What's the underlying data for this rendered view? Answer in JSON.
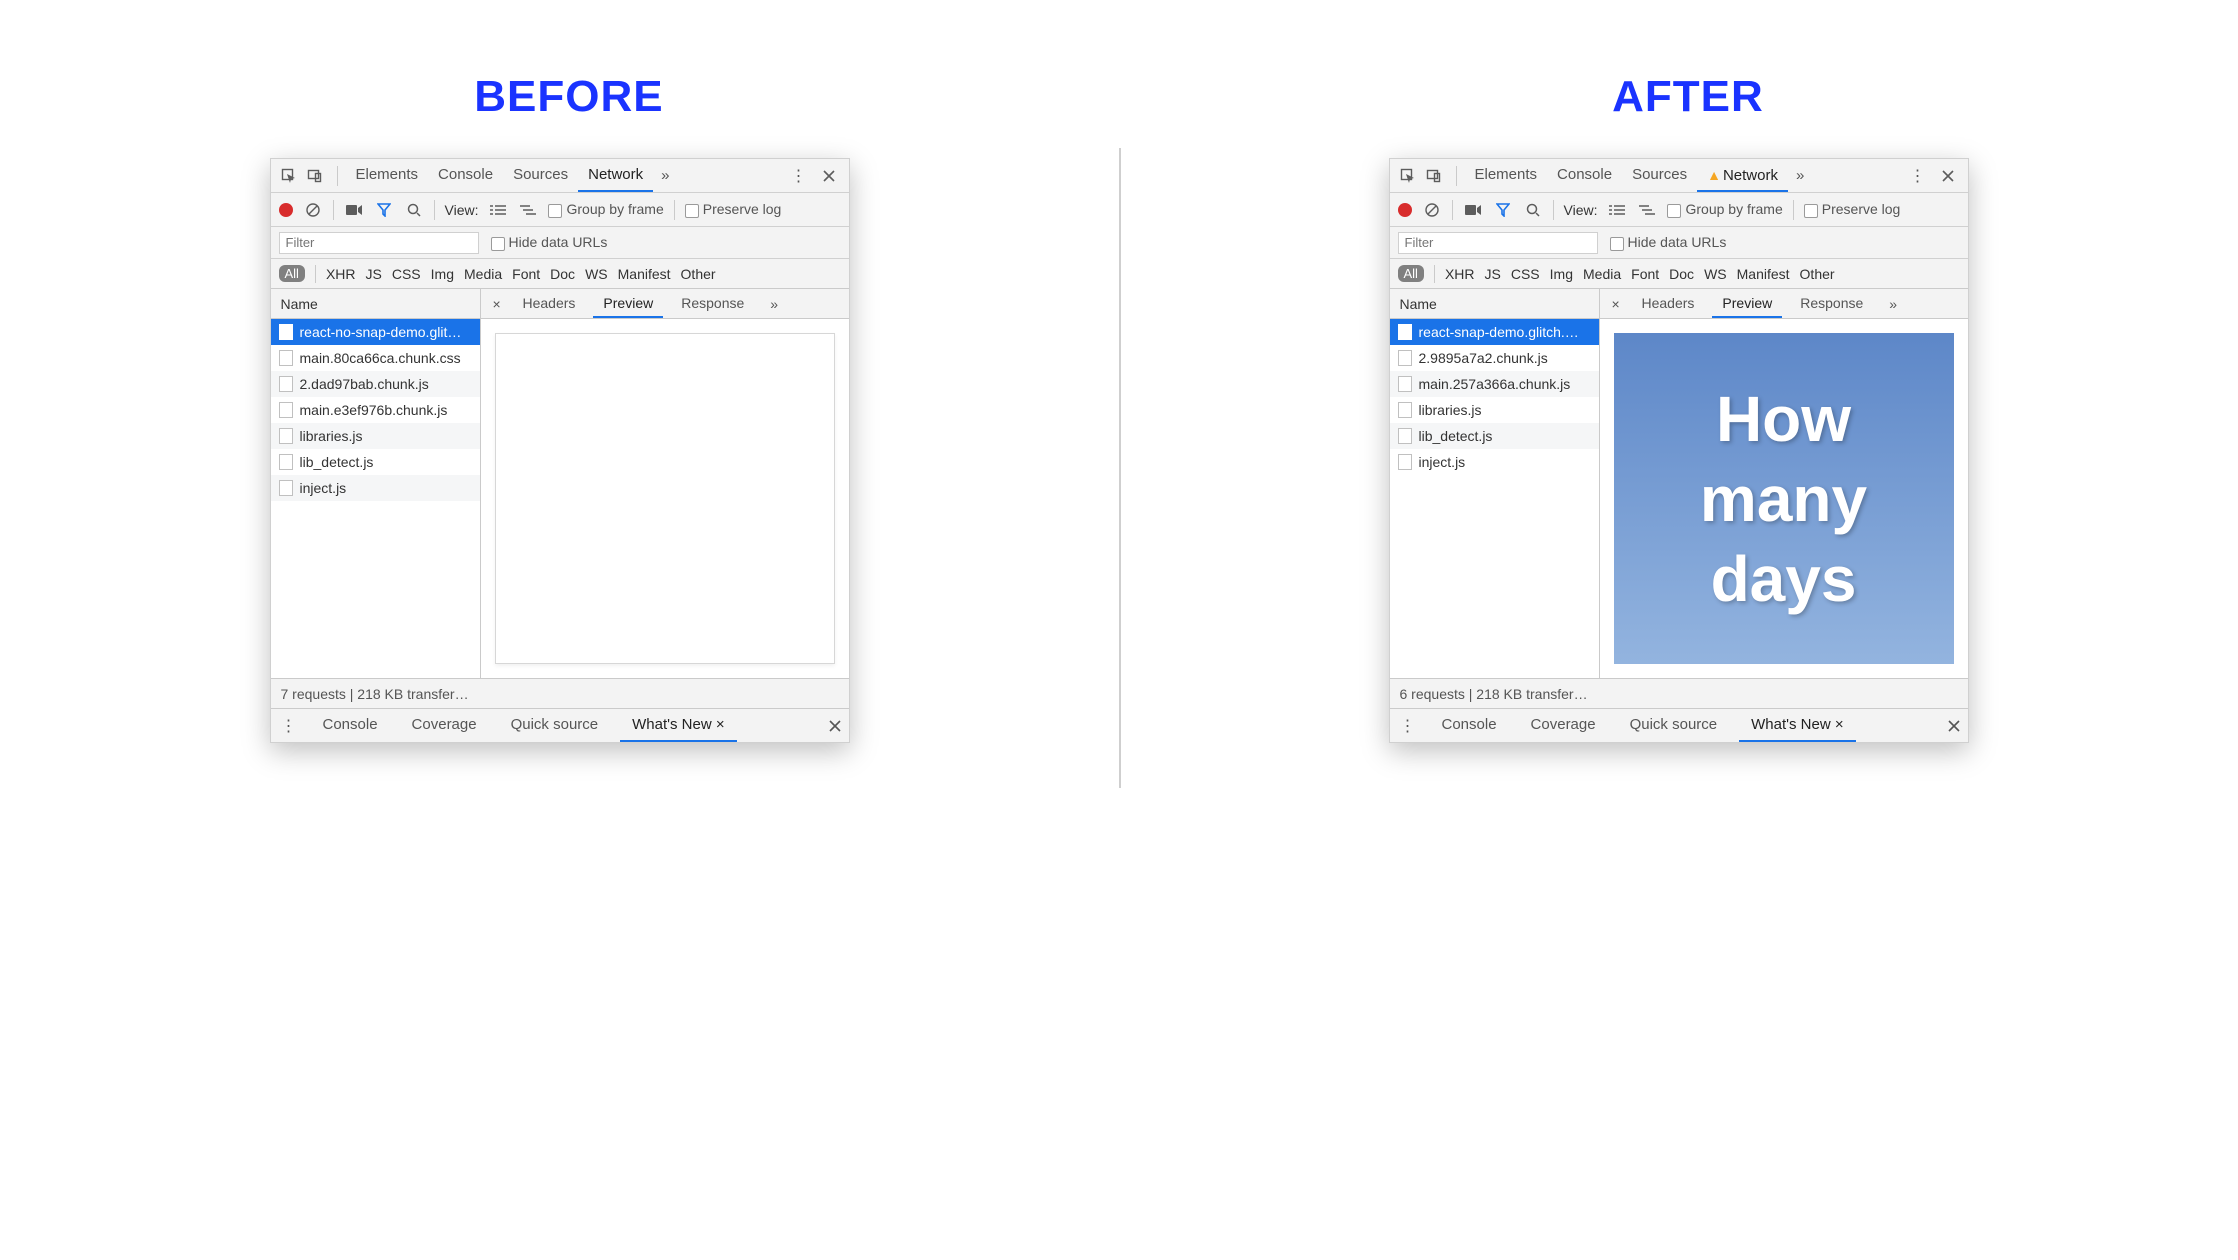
{
  "headings": {
    "before": "BEFORE",
    "after": "AFTER"
  },
  "top_tabs": {
    "elements": "Elements",
    "console": "Console",
    "sources": "Sources",
    "network": "Network"
  },
  "toolbar": {
    "view_label": "View:",
    "group_by_frame": "Group by frame",
    "preserve_log": "Preserve log"
  },
  "filter": {
    "placeholder": "Filter",
    "hide_data_urls": "Hide data URLs"
  },
  "type_filters": {
    "all": "All",
    "xhr": "XHR",
    "js": "JS",
    "css": "CSS",
    "img": "Img",
    "media": "Media",
    "font": "Font",
    "doc": "Doc",
    "ws": "WS",
    "manifest": "Manifest",
    "other": "Other"
  },
  "columns": {
    "name": "Name"
  },
  "subtabs": {
    "headers": "Headers",
    "preview": "Preview",
    "response": "Response"
  },
  "drawer": {
    "console": "Console",
    "coverage": "Coverage",
    "quick_source": "Quick source",
    "whats_new": "What's New"
  },
  "before": {
    "requests": [
      "react-no-snap-demo.glit…",
      "main.80ca66ca.chunk.css",
      "2.dad97bab.chunk.js",
      "main.e3ef976b.chunk.js",
      "libraries.js",
      "lib_detect.js",
      "inject.js"
    ],
    "status": "7 requests | 218 KB transfer…",
    "warning": false
  },
  "after": {
    "requests": [
      "react-snap-demo.glitch.…",
      "2.9895a7a2.chunk.js",
      "main.257a366a.chunk.js",
      "libraries.js",
      "lib_detect.js",
      "inject.js"
    ],
    "status": "6 requests | 218 KB transfer…",
    "warning": true,
    "preview_text_1": "How",
    "preview_text_2": "many",
    "preview_text_3": "days"
  }
}
